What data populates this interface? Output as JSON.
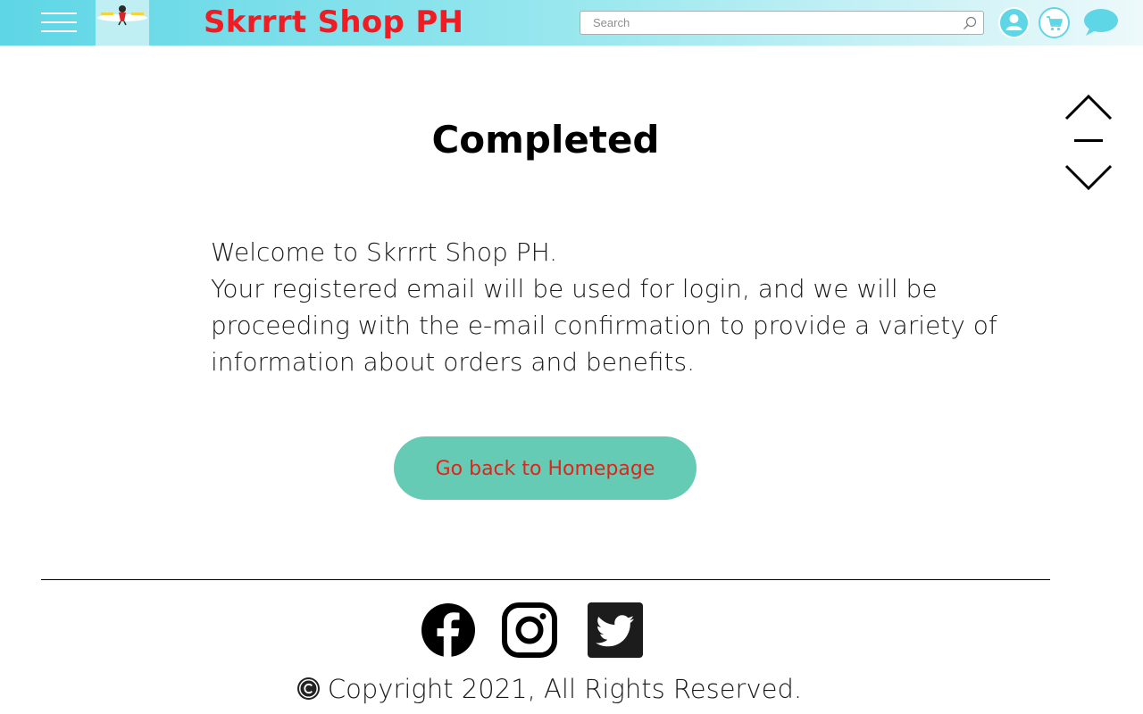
{
  "header": {
    "brand": "Skrrrt Shop PH",
    "search_placeholder": "Search",
    "icons": {
      "menu": "hamburger-menu-icon",
      "logo": "brand-logo",
      "search": "search-icon",
      "user": "user-icon",
      "cart": "cart-icon",
      "chat": "chat-bubble-icon"
    },
    "colors": {
      "bar_start": "#5ed6e6",
      "bar_end": "#eef9fb",
      "brand": "#ef1c24"
    }
  },
  "main": {
    "title": "Completed",
    "message_lines": [
      "Welcome to Skrrrt Shop PH.",
      "Your registered email will be used for login, and we will be",
      "proceeding with the e-mail confirmation to provide a variety of",
      "information about orders and benefits."
    ],
    "button_label": "Go back to Homepage",
    "button_colors": {
      "background": "#66cbb4",
      "text": "#e2231a"
    }
  },
  "scroll_controls": {
    "icons": [
      "chevron-up-icon",
      "minus-icon",
      "chevron-down-icon"
    ]
  },
  "footer": {
    "social_icons": [
      "facebook-icon",
      "instagram-icon",
      "twitter-icon"
    ],
    "copyright": "Copyright 2021, All Rights Reserved."
  }
}
